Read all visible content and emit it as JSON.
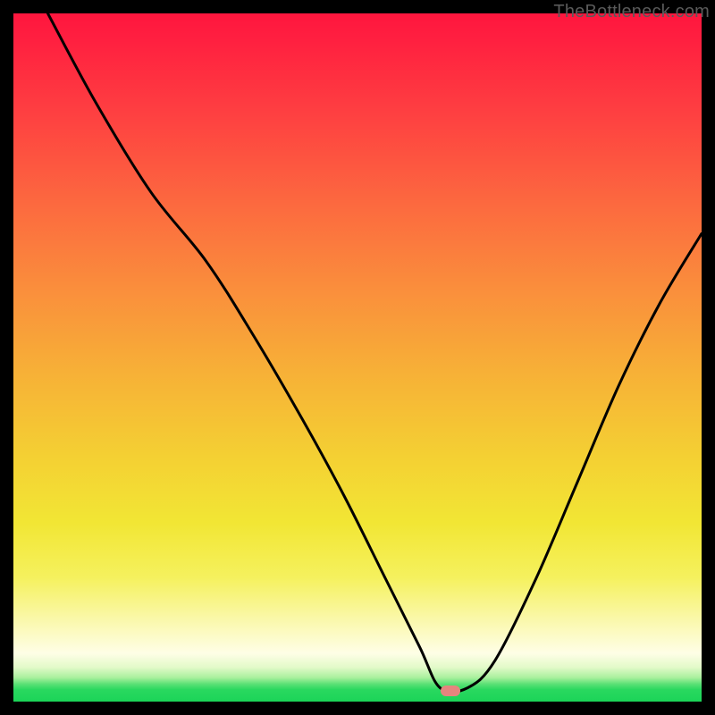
{
  "watermark": "TheBottleneck.com",
  "marker": {
    "x_frac": 0.635,
    "y_frac": 0.985
  },
  "chart_data": {
    "type": "line",
    "title": "",
    "xlabel": "",
    "ylabel": "",
    "xlim": [
      0,
      1
    ],
    "ylim": [
      0,
      1
    ],
    "annotations": [
      "TheBottleneck.com"
    ],
    "series": [
      {
        "name": "bottleneck-curve",
        "x": [
          0.05,
          0.12,
          0.2,
          0.28,
          0.35,
          0.42,
          0.48,
          0.54,
          0.59,
          0.62,
          0.66,
          0.7,
          0.76,
          0.82,
          0.88,
          0.94,
          1.0
        ],
        "y": [
          1.0,
          0.87,
          0.74,
          0.64,
          0.53,
          0.41,
          0.3,
          0.18,
          0.08,
          0.02,
          0.02,
          0.06,
          0.18,
          0.32,
          0.46,
          0.58,
          0.68
        ],
        "_comment": "y is distance above bottom, 0 = bottom edge, 1 = top edge; values estimated from pixels"
      }
    ],
    "gradient_stops": [
      {
        "pos": 0.0,
        "color": "#ff163e"
      },
      {
        "pos": 0.28,
        "color": "#fc6a3f"
      },
      {
        "pos": 0.64,
        "color": "#f4cf33"
      },
      {
        "pos": 0.93,
        "color": "#fefee6"
      },
      {
        "pos": 1.0,
        "color": "#1bd458"
      }
    ],
    "marker": {
      "x": 0.635,
      "y": 0.015,
      "color": "#e6857e"
    }
  }
}
